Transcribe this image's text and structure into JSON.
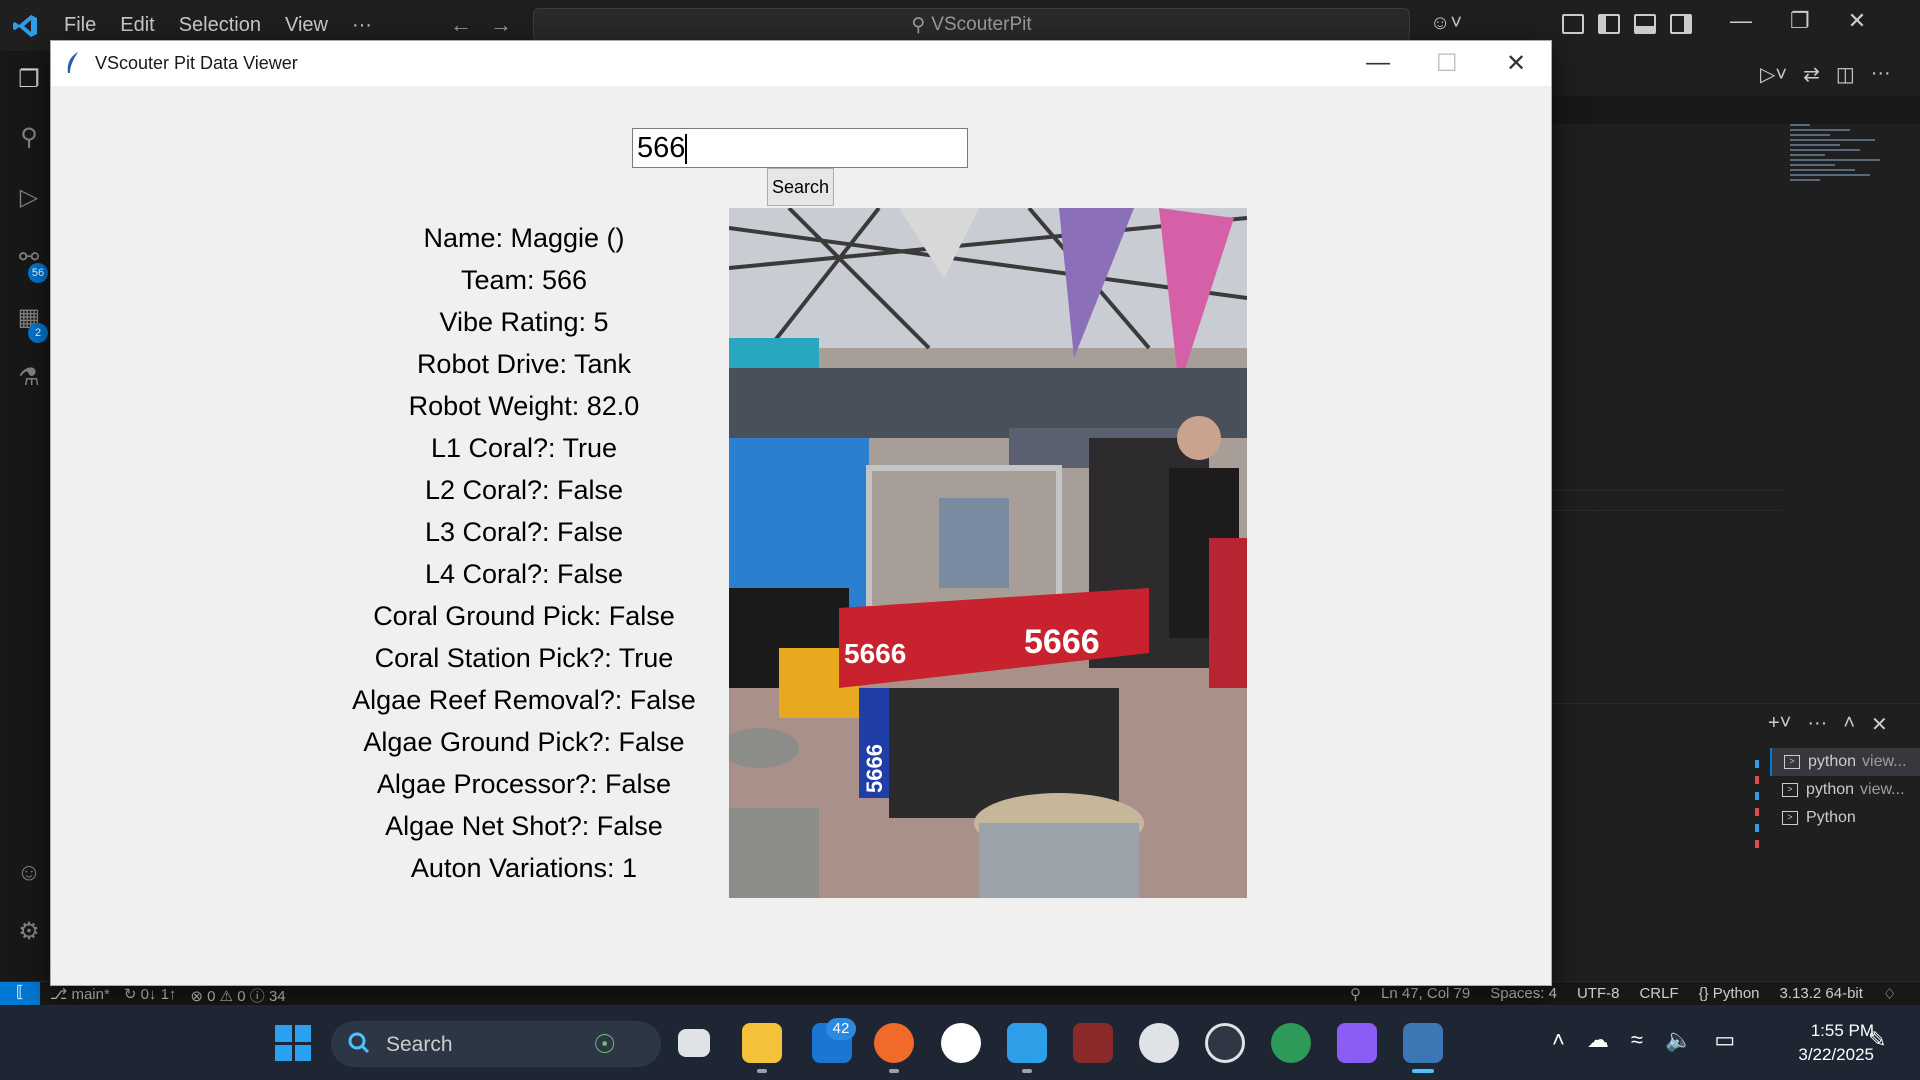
{
  "vscode": {
    "menu": [
      "File",
      "Edit",
      "Selection",
      "View",
      "···"
    ],
    "command_center": "VScouterPit",
    "badges": {
      "source_control": "56",
      "extensions": "2"
    },
    "accent_color": "#0078d4"
  },
  "terminals": [
    {
      "name": "python",
      "detail": "view...",
      "active": true
    },
    {
      "name": "python",
      "detail": "view...",
      "active": false
    },
    {
      "name": "Python",
      "detail": "",
      "active": false
    }
  ],
  "status_bar": {
    "branch": "main*",
    "sync": "0↓ 1↑",
    "problems": "⊗ 0 ⚠ 0 ⓘ 34",
    "position": "Ln 47, Col 79",
    "spaces": "Spaces: 4",
    "encoding": "UTF-8",
    "eol": "CRLF",
    "language": "{} Python",
    "interpreter": "3.13.2 64-bit"
  },
  "app": {
    "window_title": "VScouter Pit Data Viewer",
    "search_value": "566",
    "search_button": "Search",
    "fields": [
      "Name: Maggie ()",
      "Team: 566",
      "Vibe Rating: 5",
      "Robot Drive: Tank",
      "Robot Weight: 82.0",
      "L1 Coral?: True",
      "L2 Coral?: False",
      "L3 Coral?: False",
      "L4 Coral?: False",
      "Coral Ground Pick: False",
      "Coral Station Pick?: True",
      "Algae Reef Removal?: False",
      "Algae Ground Pick?: False",
      "Algae Processor?: False",
      "Algae Net Shot?: False",
      "Auton Variations: 1"
    ],
    "photo_labels": [
      "5666",
      "5666",
      "5666"
    ]
  },
  "taskbar": {
    "search_label": "Search",
    "mail_badge": "42",
    "time": "1:55 PM",
    "date": "3/22/2025"
  }
}
